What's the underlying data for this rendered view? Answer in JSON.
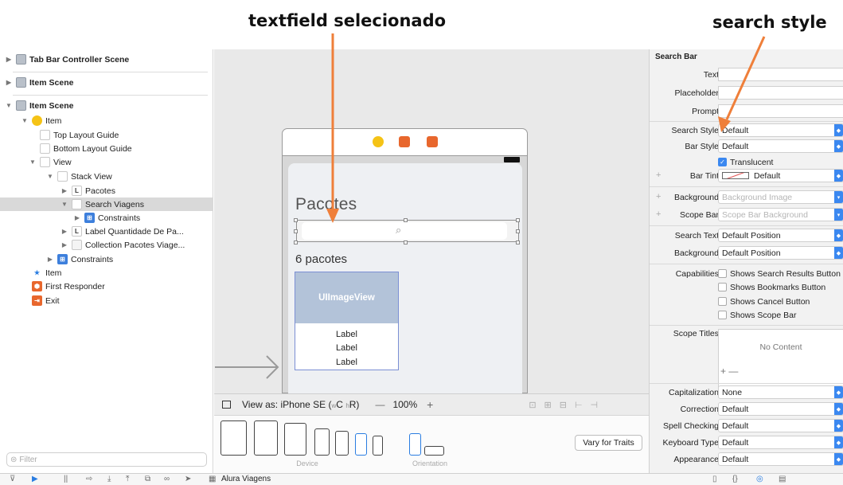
{
  "annotations": {
    "left": "textfield selecionado",
    "right": "search style"
  },
  "outline": {
    "rows": [
      {
        "label": "Tab Bar Controller Scene"
      },
      {
        "label": "Item Scene"
      },
      {
        "label": "Item Scene"
      },
      {
        "label": "Item"
      },
      {
        "label": "Top Layout Guide"
      },
      {
        "label": "Bottom Layout Guide"
      },
      {
        "label": "View"
      },
      {
        "label": "Stack View"
      },
      {
        "label": "Pacotes"
      },
      {
        "label": "Search Viagens"
      },
      {
        "label": "Constraints"
      },
      {
        "label": "Label Quantidade De Pa..."
      },
      {
        "label": "Collection Pacotes Viage..."
      },
      {
        "label": "Constraints"
      },
      {
        "label": "Item"
      },
      {
        "label": "First Responder"
      },
      {
        "label": "Exit"
      }
    ],
    "filter_placeholder": "Filter"
  },
  "canvas": {
    "nav_title": "Pacotes",
    "count_label": "6 pacotes",
    "imageview": "UIImageView",
    "labels": [
      "Label",
      "Label",
      "Label"
    ],
    "view_as": "View as: iPhone SE (",
    "size_class_w": "w",
    "size_class_c": "C",
    "size_class_h": "h",
    "size_class_r": "R)",
    "zoom": "100%",
    "device_caption": "Device",
    "orientation_caption": "Orientation",
    "vary_button": "Vary for Traits"
  },
  "inspector": {
    "section": "Search Bar",
    "text_label": "Text",
    "placeholder_label": "Placeholder",
    "prompt_label": "Prompt",
    "search_style_label": "Search Style",
    "search_style_value": "Default",
    "bar_style_label": "Bar Style",
    "bar_style_value": "Default",
    "translucent": "Translucent",
    "bar_tint_label": "Bar Tint",
    "bar_tint_value": "Default",
    "background_label": "Background",
    "background_placeholder": "Background Image",
    "scope_bar_label": "Scope Bar",
    "scope_bar_placeholder": "Scope Bar Background",
    "search_text_label": "Search Text",
    "search_text_value": "Default Position",
    "background2_label": "Background",
    "background2_value": "Default Position",
    "capabilities_label": "Capabilities",
    "capabilities": [
      "Shows Search Results Button",
      "Shows Bookmarks Button",
      "Shows Cancel Button",
      "Shows Scope Bar"
    ],
    "scope_titles_label": "Scope Titles",
    "no_content": "No Content",
    "capitalization_label": "Capitalization",
    "capitalization_value": "None",
    "correction_label": "Correction",
    "correction_value": "Default",
    "spell_label": "Spell Checking",
    "spell_value": "Default",
    "keyboard_label": "Keyboard Type",
    "keyboard_value": "Default",
    "appearance_label": "Appearance",
    "appearance_value": "Default"
  },
  "toolbar": {
    "target": "Alura Viagens"
  },
  "colors": {
    "accent": "#3b88f0",
    "arrow": "#ef7f3a",
    "selection": "#d9d9d9",
    "imageview": "#b3c3d9"
  }
}
